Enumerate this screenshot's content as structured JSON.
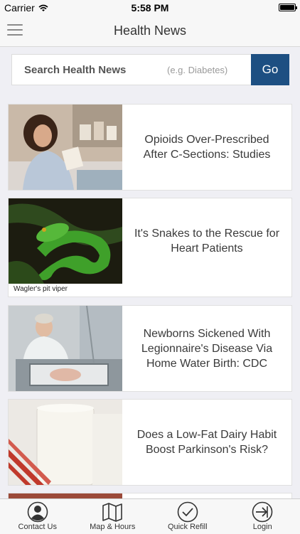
{
  "status": {
    "carrier": "Carrier",
    "time": "5:58 PM"
  },
  "nav": {
    "title": "Health News"
  },
  "search": {
    "placeholder": "Search Health News",
    "hint": "(e.g. Diabetes)",
    "go": "Go"
  },
  "articles": [
    {
      "headline": "Opioids Over-Prescribed After C-Sections: Studies"
    },
    {
      "headline": "It's Snakes to the Rescue for Heart Patients",
      "caption": "Wagler's pit viper"
    },
    {
      "headline": "Newborns Sickened With Legionnaire's Disease Via Home Water Birth: CDC"
    },
    {
      "headline": "Does a Low-Fat Dairy Habit Boost Parkinson's Risk?"
    }
  ],
  "tabs": [
    {
      "label": "Contact Us",
      "icon": "person-icon"
    },
    {
      "label": "Map & Hours",
      "icon": "map-icon"
    },
    {
      "label": "Quick Refill",
      "icon": "check-circle-icon"
    },
    {
      "label": "Login",
      "icon": "login-icon"
    }
  ]
}
